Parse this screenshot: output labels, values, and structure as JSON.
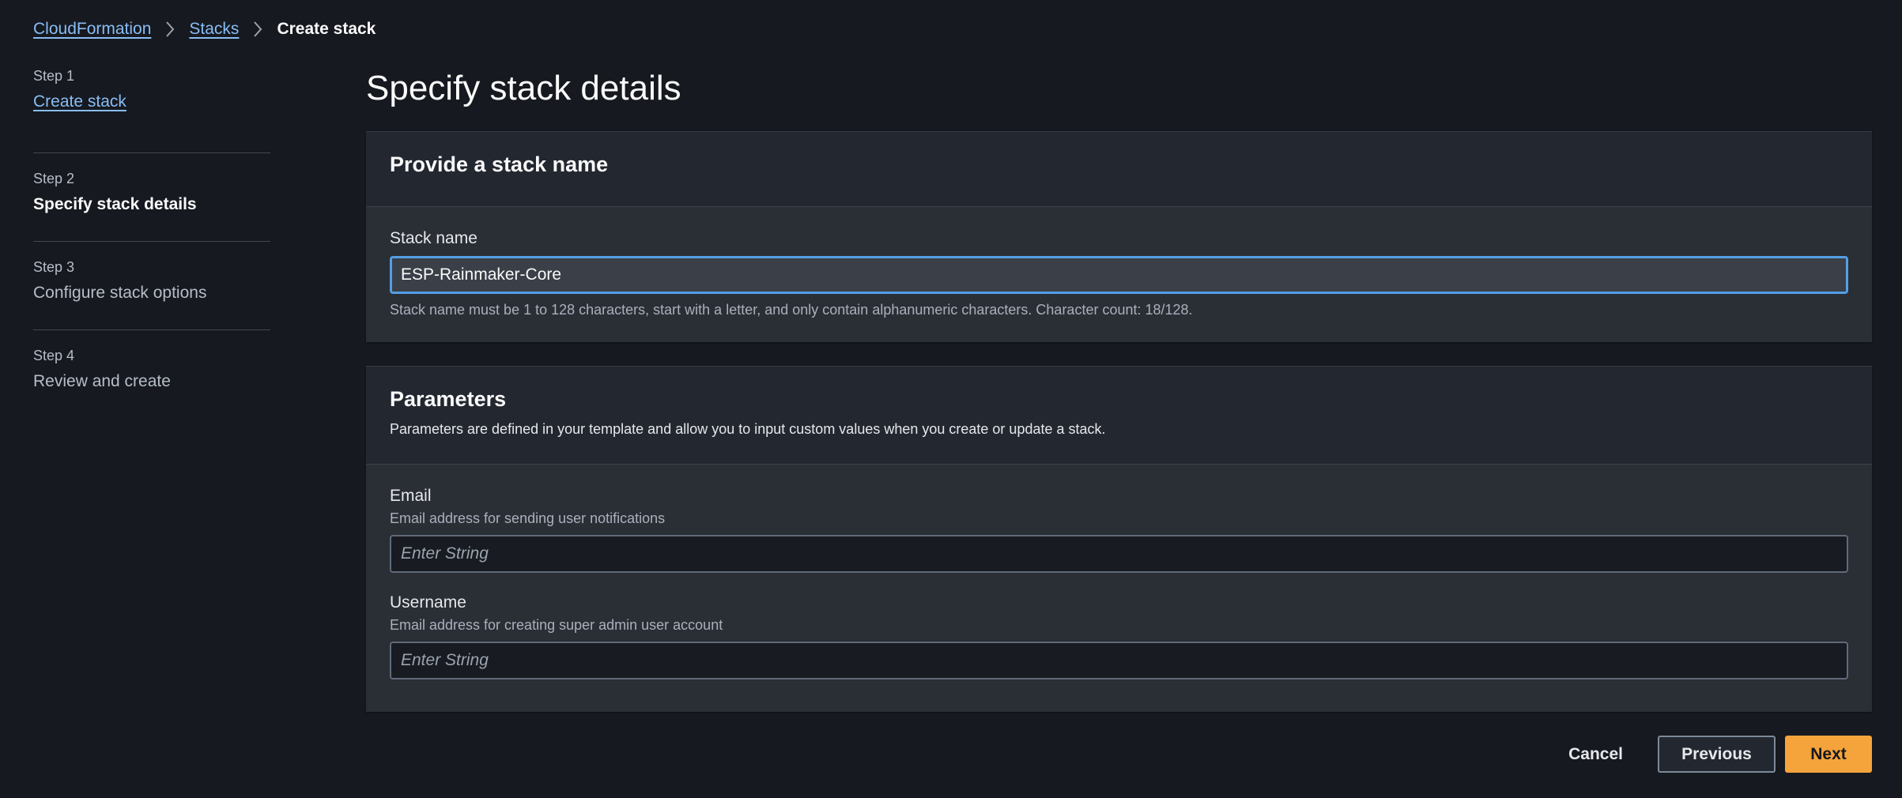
{
  "breadcrumb": {
    "items": [
      "CloudFormation",
      "Stacks"
    ],
    "current": "Create stack"
  },
  "wizard": {
    "steps": [
      {
        "number": "Step 1",
        "title": "Create stack"
      },
      {
        "number": "Step 2",
        "title": "Specify stack details"
      },
      {
        "number": "Step 3",
        "title": "Configure stack options"
      },
      {
        "number": "Step 4",
        "title": "Review and create"
      }
    ]
  },
  "page": {
    "title": "Specify stack details"
  },
  "stack_name_section": {
    "title": "Provide a stack name",
    "field_label": "Stack name",
    "field_value": "ESP-Rainmaker-Core",
    "constraint": "Stack name must be 1 to 128 characters, start with a letter, and only contain alphanumeric characters. Character count: 18/128."
  },
  "parameters_section": {
    "title": "Parameters",
    "description": "Parameters are defined in your template and allow you to input custom values when you create or update a stack.",
    "fields": [
      {
        "label": "Email",
        "description": "Email address for sending user notifications",
        "placeholder": "Enter String",
        "value": ""
      },
      {
        "label": "Username",
        "description": "Email address for creating super admin user account",
        "placeholder": "Enter String",
        "value": ""
      }
    ]
  },
  "actions": {
    "cancel": "Cancel",
    "previous": "Previous",
    "next": "Next"
  },
  "colors": {
    "background": "#16191f",
    "link": "#89bdf5",
    "primary": "#f5a33b",
    "focus": "#539fe5"
  }
}
